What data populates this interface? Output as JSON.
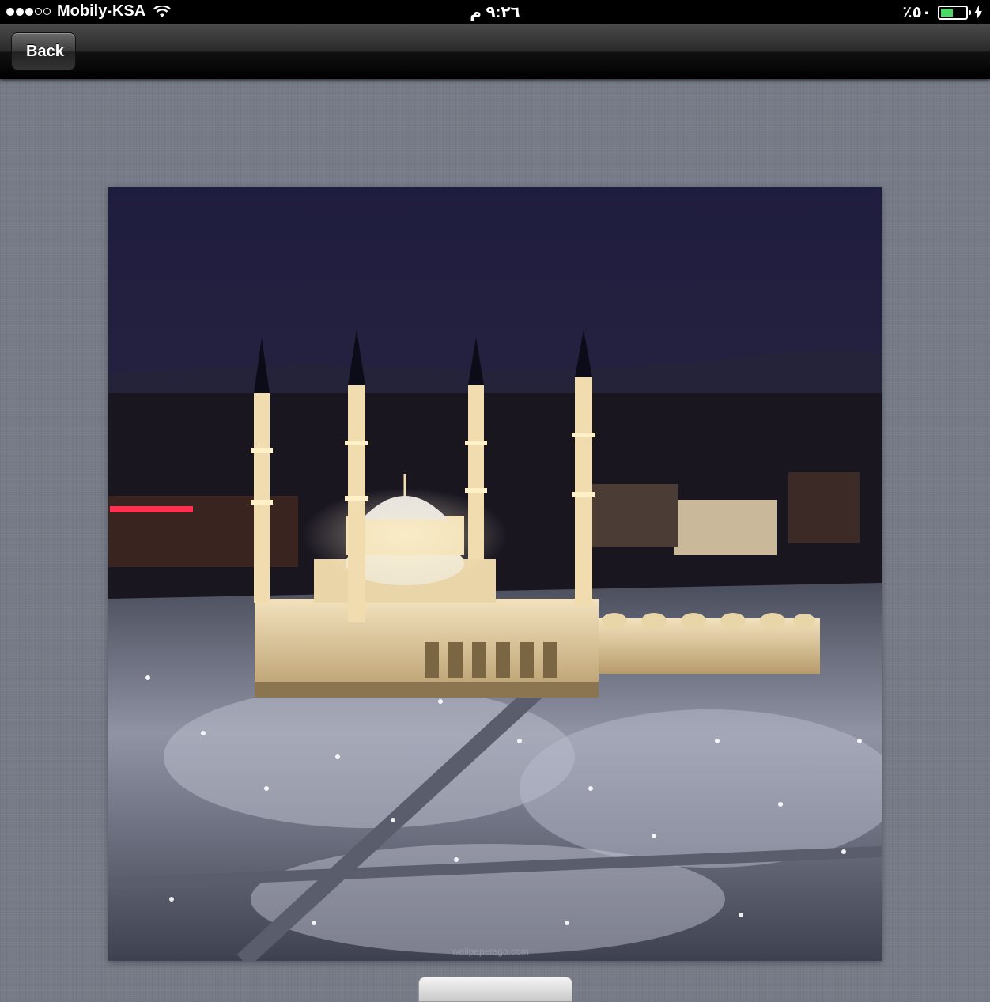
{
  "status_bar": {
    "carrier": "Mobily-KSA",
    "time": "٩:٢٦ م",
    "battery_label": "٪٥٠",
    "battery_level": 0.5,
    "signal_strength": 3,
    "icons": [
      "signal-dots-icon",
      "wifi-icon",
      "battery-icon",
      "charging-bolt-icon"
    ]
  },
  "nav_bar": {
    "back_label": "Back"
  },
  "photo": {
    "subject": "mosque-night-photo",
    "watermark": "wallpapersgo.com"
  },
  "colors": {
    "nav_dark": "#000000",
    "background_linen": "#767b87",
    "battery_green": "#4cd964"
  }
}
